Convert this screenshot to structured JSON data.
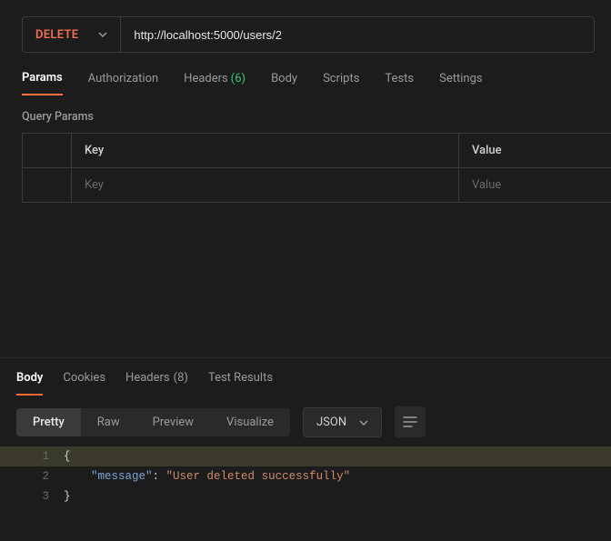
{
  "request": {
    "method": "DELETE",
    "url": "http://localhost:5000/users/2"
  },
  "tabs": {
    "params": "Params",
    "authorization": "Authorization",
    "headers": "Headers",
    "headers_count": "(6)",
    "body": "Body",
    "scripts": "Scripts",
    "tests": "Tests",
    "settings": "Settings"
  },
  "query_params": {
    "section_label": "Query Params",
    "col_key": "Key",
    "col_value": "Value",
    "placeholder_key": "Key",
    "placeholder_value": "Value"
  },
  "response_tabs": {
    "body": "Body",
    "cookies": "Cookies",
    "headers": "Headers",
    "headers_count": "(8)",
    "test_results": "Test Results"
  },
  "view_modes": {
    "pretty": "Pretty",
    "raw": "Raw",
    "preview": "Preview",
    "visualize": "Visualize"
  },
  "format": {
    "label": "JSON"
  },
  "code": {
    "l1_num": "1",
    "l1_txt": "{",
    "l2_num": "2",
    "l2_indent": "    ",
    "l2_key": "\"message\"",
    "l2_colon": ": ",
    "l2_val": "\"User deleted successfully\"",
    "l3_num": "3",
    "l3_txt": "}"
  }
}
